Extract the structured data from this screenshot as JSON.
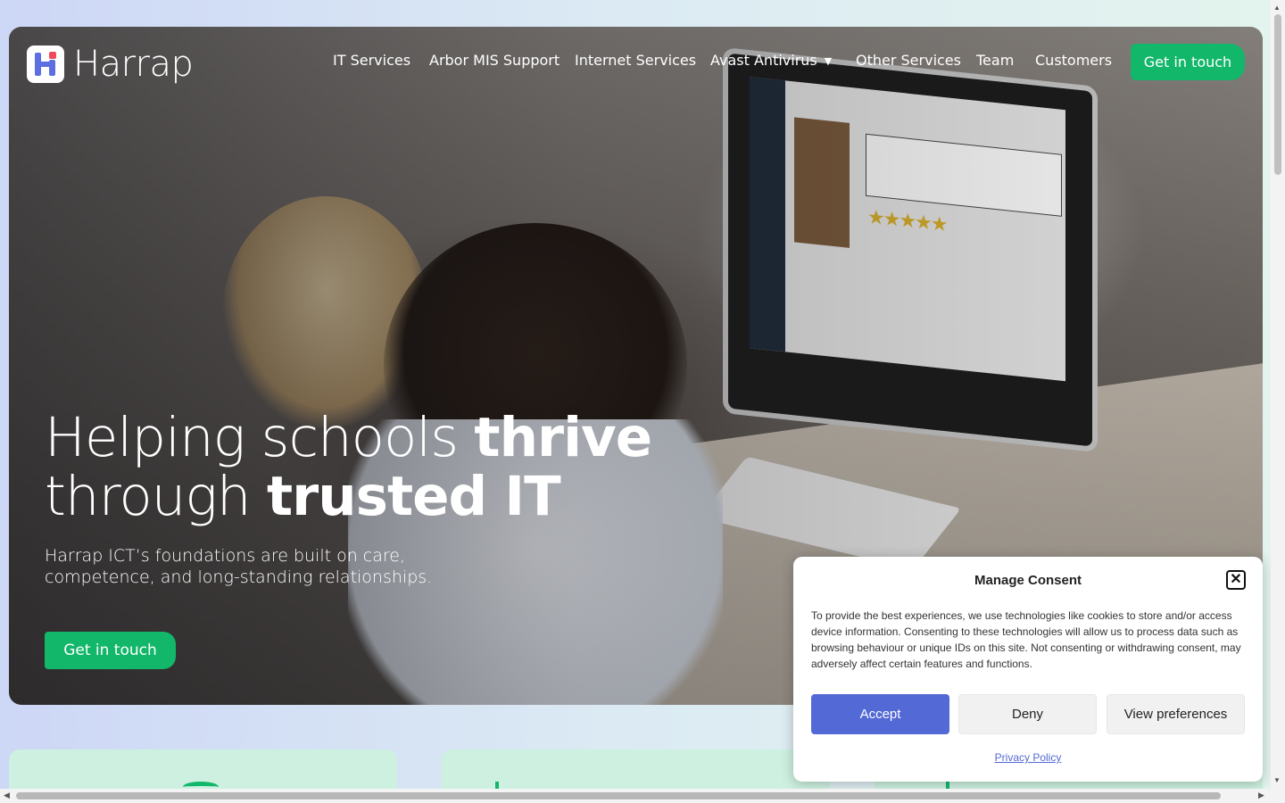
{
  "brand": {
    "name": "Harrap"
  },
  "nav": {
    "items": [
      {
        "label": "IT Services"
      },
      {
        "label": "Arbor MIS Support"
      },
      {
        "label": "Internet Services"
      },
      {
        "label": "Avast Antivirus",
        "has_dropdown": true
      },
      {
        "label": "Other Services"
      },
      {
        "label": "Team"
      },
      {
        "label": "Customers"
      }
    ],
    "cta": "Get in touch"
  },
  "hero": {
    "headline_part1": "Helping schools ",
    "headline_bold1": "thrive",
    "headline_part2": "through ",
    "headline_bold2": "trusted IT",
    "subtext": "Harrap ICT’s foundations are built on care, competence, and long-standing relationships.",
    "cta": "Get in touch"
  },
  "consent": {
    "title": "Manage Consent",
    "message": "To provide the best experiences, we use technologies like cookies to store and/or access device information. Consenting to these technologies will allow us to process data such as browsing behaviour or unique IDs on this site. Not consenting or withdrawing consent, may adversely affect certain features and functions.",
    "accept": "Accept",
    "deny": "Deny",
    "preferences": "View preferences",
    "privacy_link": "Privacy Policy"
  },
  "colors": {
    "accent_green": "#12b76a",
    "accept_blue": "#5369d6",
    "logo_blue": "#5c6ee0",
    "logo_red": "#ef4a5a"
  },
  "icons": {
    "close": "close-icon",
    "dropdown": "chevron-down-icon",
    "logo": "harrap-logo-icon"
  }
}
